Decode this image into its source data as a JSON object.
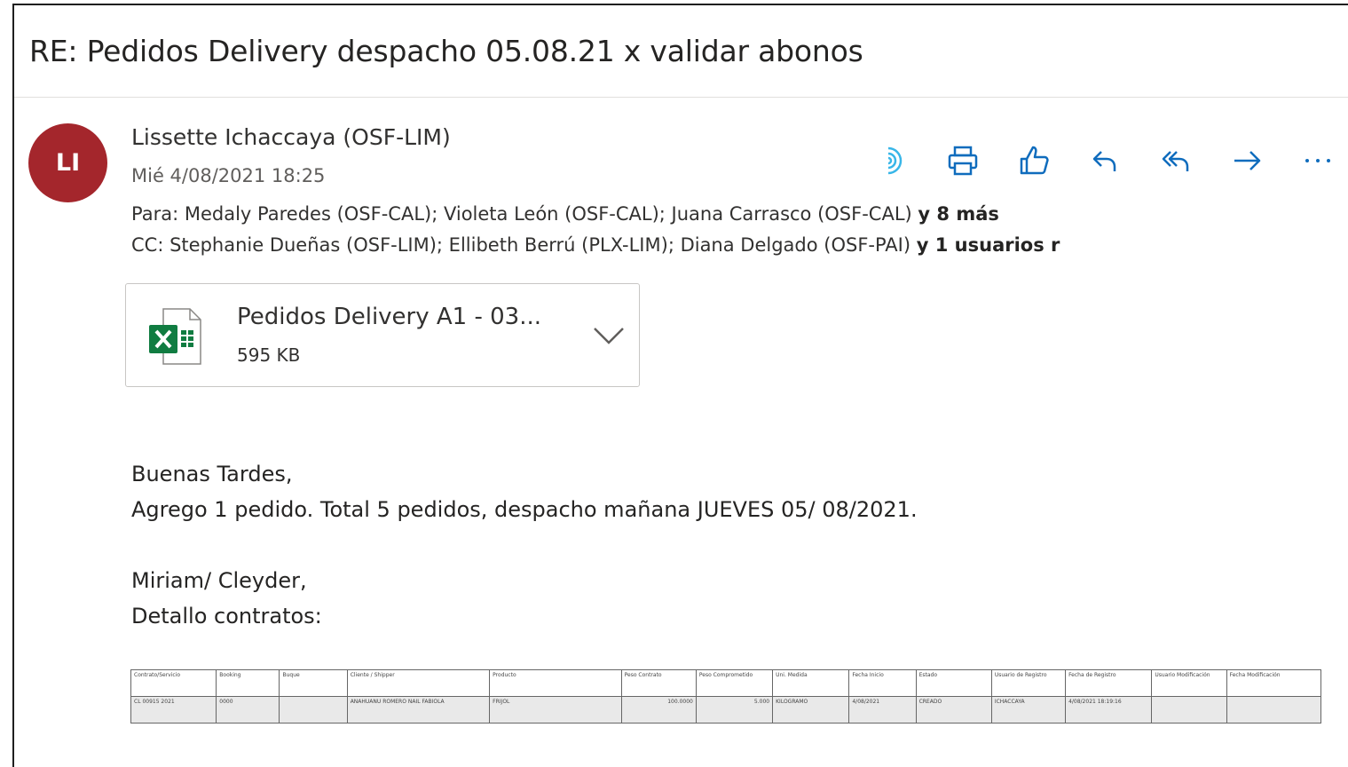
{
  "email": {
    "subject": "RE: Pedidos Delivery despacho 05.08.21 x validar abonos",
    "avatar_initials": "LI",
    "avatar_color": "#a4262c",
    "sender": "Lissette Ichaccaya (OSF-LIM)",
    "date": "Mié 4/08/2021 18:25",
    "to_label": "Para:",
    "to_list": "Medaly Paredes (OSF-CAL); Violeta León (OSF-CAL); Juana Carrasco (OSF-CAL)",
    "to_more": "y 8 más",
    "cc_label": "CC:",
    "cc_list": "Stephanie Dueñas (OSF-LIM); Ellibeth Berrú (PLX-LIM); Diana Delgado (OSF-PAI)",
    "cc_more": "y 1 usuarios r"
  },
  "actions": [
    {
      "name": "immersive-reader-icon"
    },
    {
      "name": "print-icon"
    },
    {
      "name": "like-icon"
    },
    {
      "name": "reply-icon"
    },
    {
      "name": "reply-all-icon"
    },
    {
      "name": "forward-icon"
    },
    {
      "name": "more-options-icon"
    }
  ],
  "attachment": {
    "name": "Pedidos Delivery A1 - 03...",
    "size": "595 KB",
    "icon": "excel-icon",
    "accent": "#107c41"
  },
  "body": {
    "greeting": "Buenas Tardes,",
    "line1": "Agrego 1 pedido. Total 5 pedidos, despacho mañana JUEVES  05/ 08/2021.",
    "line2": "Miriam/ Cleyder,",
    "line3": "Detallo contratos:"
  },
  "table": {
    "headers": [
      "Contrato/Servicio",
      "Booking",
      "Buque",
      "Cliente / Shipper",
      "Producto",
      "Peso Contrato",
      "Peso Comprometido",
      "Uni. Medida",
      "Fecha Inicio",
      "Estado",
      "Usuario de Registro",
      "Fecha de Registro",
      "Usuario Modificación",
      "Fecha Modificación"
    ],
    "row": [
      "CL 00915 2021",
      "0000",
      "",
      "ANAHUANU ROMERO NAIL FABIOLA",
      "FRIJOL",
      "100.0000",
      "5.000",
      "KILOGRAMO",
      "4/08/2021",
      "CREADO",
      "ICHACCAYA",
      "4/08/2021 18:19:16",
      "",
      ""
    ]
  }
}
